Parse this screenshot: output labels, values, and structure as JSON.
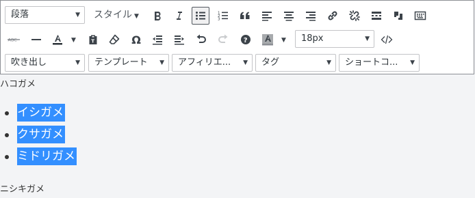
{
  "toolbar": {
    "row1": {
      "format_select": "段落",
      "style_menu": "スタイル"
    },
    "row2": {
      "font_size_select": "18px"
    },
    "row3": {
      "speech_bubble_select": "吹き出し",
      "template_select": "テンプレート",
      "affiliate_select": "アフィリエ...",
      "tag_select": "タグ",
      "shortcode_select": "ショートコ..."
    },
    "strikethrough_icon_text": "ABC",
    "omega_glyph": "Ω"
  },
  "content": {
    "paragraph_before": "ハコガメ",
    "list_items": [
      "イシガメ",
      "クサガメ",
      "ミドリガメ"
    ],
    "paragraph_after": "ニシキガメ",
    "highlight_color": "#338fff"
  }
}
